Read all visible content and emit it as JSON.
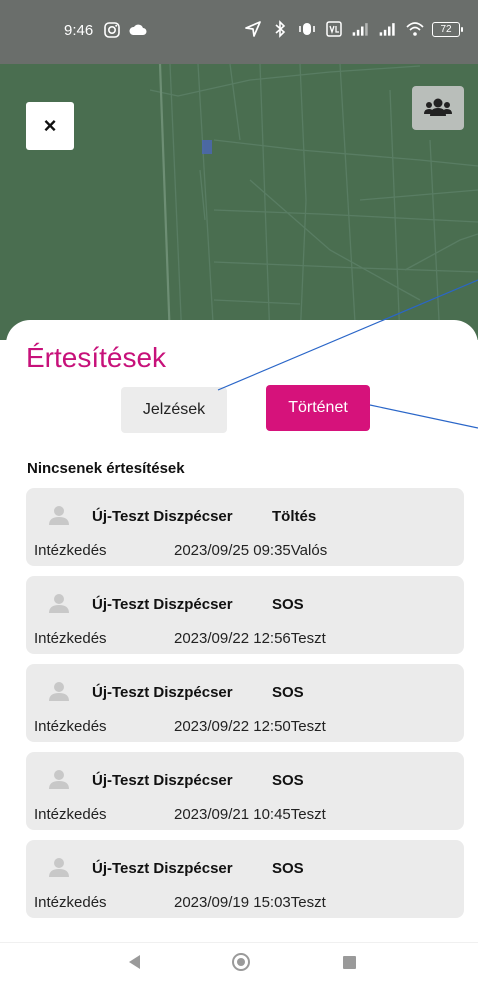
{
  "statusbar": {
    "time": "9:46",
    "battery": "72",
    "icons": [
      "instagram-icon",
      "cloud-icon",
      "location-arrow-icon",
      "bluetooth-icon",
      "vibrate-icon",
      "volte-icon",
      "signal-icon",
      "signal-icon",
      "wifi-icon",
      "battery-icon"
    ]
  },
  "map": {
    "close_label": "×",
    "group_icon": "group-users-icon"
  },
  "sheet": {
    "title": "Értesítések",
    "tabs": [
      {
        "label": "Jelzések",
        "active": false
      },
      {
        "label": "Történet",
        "active": true
      }
    ],
    "empty_label": "Nincsenek értesítések",
    "notifications": [
      {
        "sender": "Új-Teszt Diszpécser",
        "type": "Töltés",
        "action": "Intézkedés",
        "date": "2023/09/25 09:35",
        "status": "Valós"
      },
      {
        "sender": "Új-Teszt Diszpécser",
        "type": "SOS",
        "action": "Intézkedés",
        "date": "2023/09/22 12:56",
        "status": "Teszt"
      },
      {
        "sender": "Új-Teszt Diszpécser",
        "type": "SOS",
        "action": "Intézkedés",
        "date": "2023/09/22 12:50",
        "status": "Teszt"
      },
      {
        "sender": "Új-Teszt Diszpécser",
        "type": "SOS",
        "action": "Intézkedés",
        "date": "2023/09/21 10:45",
        "status": "Teszt"
      },
      {
        "sender": "Új-Teszt Diszpécser",
        "type": "SOS",
        "action": "Intézkedés",
        "date": "2023/09/19 15:03",
        "status": "Teszt"
      }
    ]
  },
  "colors": {
    "accent": "#d6127b",
    "title": "#c7117a",
    "map": "#4a6e50",
    "card": "#ebebeb"
  },
  "navbar": {
    "icons": [
      "back-icon",
      "home-icon",
      "recent-apps-icon"
    ]
  }
}
